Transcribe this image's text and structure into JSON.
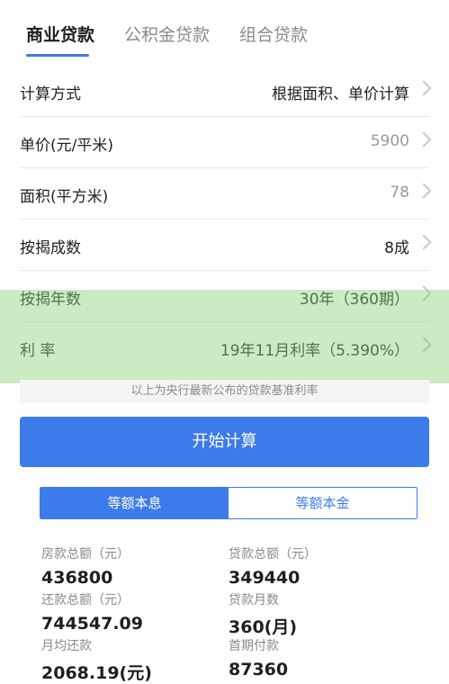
{
  "tabs": [
    {
      "label": "商业贷款"
    },
    {
      "label": "公积金贷款"
    },
    {
      "label": "组合贷款"
    }
  ],
  "form": {
    "calc_method": {
      "label": "计算方式",
      "value": "根据面积、单价计算"
    },
    "unit_price": {
      "label": "单价(元/平米)",
      "value": "5900"
    },
    "area": {
      "label": "面积(平方米)",
      "value": "78"
    },
    "loan_ratio": {
      "label": "按揭成数",
      "value": "8成"
    },
    "loan_years": {
      "label": "按揭年数",
      "value": "30年（360期）"
    },
    "rate": {
      "label": "利 率",
      "value": "19年11月利率（5.390%）"
    }
  },
  "note": "以上为央行最新公布的贷款基准利率",
  "start_button": "开始计算",
  "segment": {
    "active": "等额本息",
    "inactive": "等额本金"
  },
  "results": {
    "house_total": {
      "label": "房款总额（元）",
      "value": "436800"
    },
    "loan_total": {
      "label": "贷款总额（元）",
      "value": "349440"
    },
    "repay_total": {
      "label": "还款总额（元）",
      "value": "744547.09"
    },
    "loan_months": {
      "label": "贷款月数",
      "value": "360(月)"
    },
    "monthly": {
      "label": "月均还款",
      "value": "2068.19(元)"
    },
    "down_payment": {
      "label": "首期付款",
      "value": "87360"
    }
  }
}
